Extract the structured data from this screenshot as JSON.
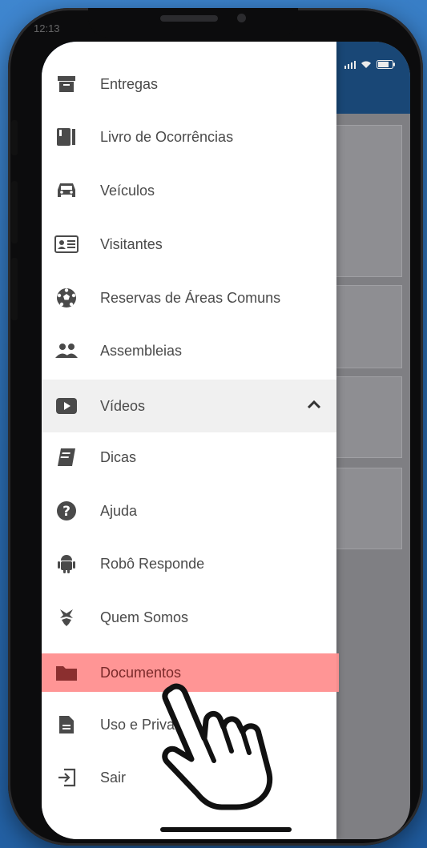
{
  "status_bar": {
    "time": "12:13"
  },
  "menu": {
    "items": [
      {
        "label": "Entregas",
        "icon": "archive-icon"
      },
      {
        "label": "Livro de Ocorrências",
        "icon": "book-icon"
      },
      {
        "label": "Veículos",
        "icon": "car-icon"
      },
      {
        "label": "Visitantes",
        "icon": "id-card-icon"
      },
      {
        "label": "Reservas de Áreas Comuns",
        "icon": "soccer-ball-icon"
      },
      {
        "label": "Assembleias",
        "icon": "people-icon"
      },
      {
        "label": "Vídeos",
        "icon": "video-icon"
      },
      {
        "label": "Dicas",
        "icon": "notebook-icon"
      },
      {
        "label": "Ajuda",
        "icon": "help-icon"
      },
      {
        "label": "Robô Responde",
        "icon": "android-icon"
      },
      {
        "label": "Quem Somos",
        "icon": "logo-icon"
      },
      {
        "label": "Documentos",
        "icon": "folder-icon"
      },
      {
        "label": "Uso e Privac",
        "icon": "document-icon"
      },
      {
        "label": "Sair",
        "icon": "logout-icon"
      }
    ]
  },
  "colors": {
    "appbar": "#1c4e80",
    "highlight": "#ff8f8f",
    "icon": "#4a4a4a"
  }
}
